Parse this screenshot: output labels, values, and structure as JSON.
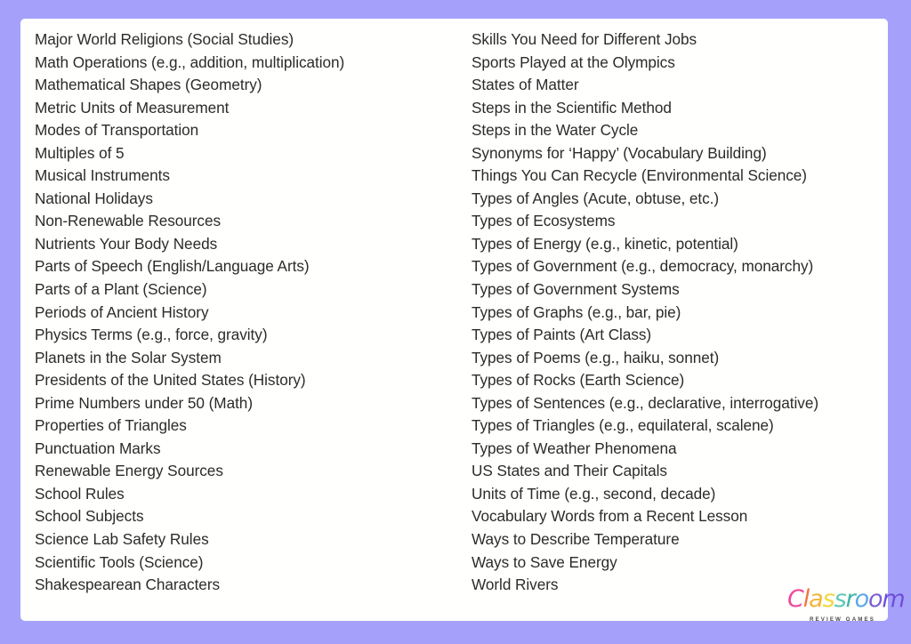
{
  "page": {
    "border_color": "#a5a1fb",
    "card_color": "#fffffd",
    "text_color": "#2b2b2b"
  },
  "topics": {
    "left_column": [
      "Major World Religions (Social Studies)",
      "Math Operations (e.g., addition, multiplication)",
      "Mathematical Shapes (Geometry)",
      "Metric Units of Measurement",
      "Modes of Transportation",
      "Multiples of 5",
      "Musical Instruments",
      "National Holidays",
      "Non-Renewable Resources",
      "Nutrients Your Body Needs",
      "Parts of Speech (English/Language Arts)",
      "Parts of a Plant (Science)",
      "Periods of Ancient History",
      "Physics Terms (e.g., force, gravity)",
      "Planets in the Solar System",
      "Presidents of the United States (History)",
      "Prime Numbers under 50 (Math)",
      "Properties of Triangles",
      "Punctuation Marks",
      "Renewable Energy Sources",
      "School Rules",
      "School Subjects",
      "Science Lab Safety Rules",
      "Scientific Tools (Science)",
      "Shakespearean Characters"
    ],
    "right_column": [
      "Skills You Need for Different Jobs",
      "Sports Played at the Olympics",
      "States of Matter",
      "Steps in the Scientific Method",
      "Steps in the Water Cycle",
      "Synonyms for ‘Happy’ (Vocabulary Building)",
      "Things You Can Recycle (Environmental Science)",
      "Types of Angles (Acute, obtuse, etc.)",
      "Types of Ecosystems",
      "Types of Energy (e.g., kinetic, potential)",
      "Types of Government (e.g., democracy, monarchy)",
      "Types of Government Systems",
      "Types of Graphs (e.g., bar, pie)",
      "Types of Paints (Art Class)",
      "Types of Poems (e.g., haiku, sonnet)",
      "Types of Rocks (Earth Science)",
      "Types of Sentences (e.g., declarative, interrogative)",
      "Types of Triangles (e.g., equilateral, scalene)",
      "Types of Weather Phenomena",
      "US States and Their Capitals",
      "Units of Time (e.g., second, decade)",
      "Vocabulary Words from a Recent Lesson",
      "Ways to Describe Temperature",
      "Ways to Save Energy",
      "World Rivers"
    ]
  },
  "logo": {
    "wordmark": "Classroom",
    "tagline": "REVIEW GAMES",
    "letters": [
      {
        "char": "C",
        "color": "#ee4c9b"
      },
      {
        "char": "l",
        "color": "#f2733f"
      },
      {
        "char": "a",
        "color": "#f3b43c"
      },
      {
        "char": "s",
        "color": "#f0d73f"
      },
      {
        "char": "s",
        "color": "#5ec9b6"
      },
      {
        "char": "r",
        "color": "#3fb6a8"
      },
      {
        "char": "o",
        "color": "#5aa9e6"
      },
      {
        "char": "o",
        "color": "#7b5fd4"
      },
      {
        "char": "m",
        "color": "#6f4ed8"
      }
    ]
  }
}
